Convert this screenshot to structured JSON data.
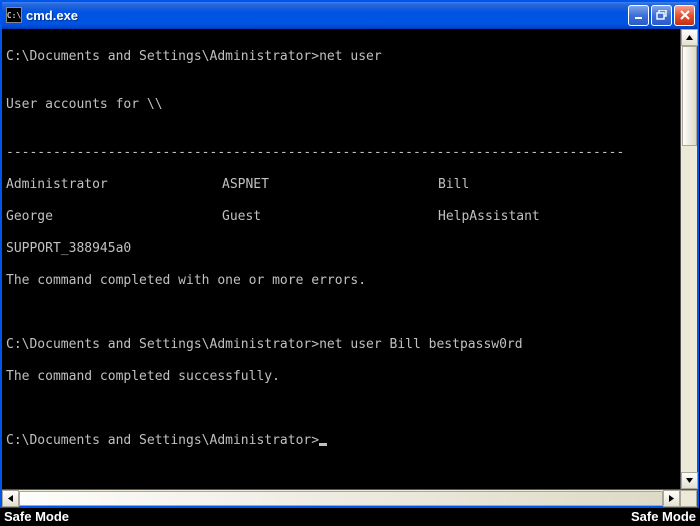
{
  "window": {
    "title": "cmd.exe",
    "icon_label": "C:\\"
  },
  "terminal": {
    "prompt1": "C:\\Documents and Settings\\Administrator>",
    "cmd1": "net user",
    "blank": "",
    "accounts_header": "User accounts for \\\\",
    "separator": "-------------------------------------------------------------------------------",
    "row1_col1": "Administrator",
    "row1_col2": "ASPNET",
    "row1_col3": "Bill",
    "row2_col1": "George",
    "row2_col2": "Guest",
    "row2_col3": "HelpAssistant",
    "row3_col1": "SUPPORT_388945a0",
    "status1": "The command completed with one or more errors.",
    "prompt2": "C:\\Documents and Settings\\Administrator>",
    "cmd2": "net user Bill bestpassw0rd",
    "status2": "The command completed successfully.",
    "prompt3": "C:\\Documents and Settings\\Administrator>"
  },
  "footer": {
    "safemode": "Safe Mode"
  }
}
